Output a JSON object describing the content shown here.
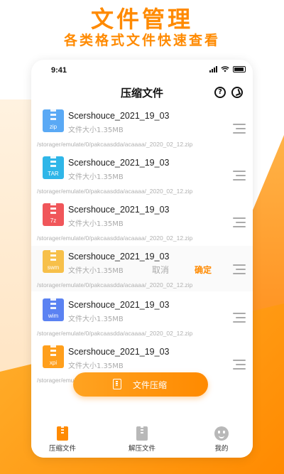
{
  "hero": {
    "title": "文件管理",
    "subtitle": "各类格式文件快速查看"
  },
  "status_bar": {
    "time": "9:41"
  },
  "nav": {
    "title": "压缩文件",
    "help_glyph": "?"
  },
  "files": [
    {
      "name": "Scershouce_2021_19_03",
      "size": "文件大小1.35MB",
      "path": "/storager/emulate/0/pakcaasdda/acaaaa/_2020_02_12.zip",
      "ext": "zip",
      "icon_color": "#5aa9f5"
    },
    {
      "name": "Scershouce_2021_19_03",
      "size": "文件大小1.35MB",
      "path": "/storager/emulate/0/pakcaasdda/acaaaa/_2020_02_12.zip",
      "ext": "TAR",
      "icon_color": "#2fb6e8"
    },
    {
      "name": "Scershouce_2021_19_03",
      "size": "文件大小1.35MB",
      "path": "/storager/emulate/0/pakcaasdda/acaaaa/_2020_02_12.zip",
      "ext": "7z",
      "icon_color": "#f0565a"
    },
    {
      "name": "Scershouce_2021_19_03",
      "size": "文件大小1.35MB",
      "path": "/storager/emulate/0/pakcaasdda/acaaaa/_2020_02_12.zip",
      "ext": "swm",
      "icon_color": "#f7c04a"
    },
    {
      "name": "Scershouce_2021_19_03",
      "size": "文件大小1.35MB",
      "path": "/storager/emulate/0/pakcaasdda/acaaaa/_2020_02_12.zip",
      "ext": "wim",
      "icon_color": "#5b82f2"
    },
    {
      "name": "Scershouce_2021_19_03",
      "size": "文件大小1.35MB",
      "path": "/storager/emulate/0/pakcaasdda/acaaaa/_2020_02_12.zip",
      "ext": "xpi",
      "icon_color": "#ff9f1c"
    }
  ],
  "inline_actions": {
    "cancel": "取消",
    "confirm": "确定"
  },
  "fab": {
    "label": "文件压缩"
  },
  "tabs": [
    {
      "label": "压缩文件",
      "active": true
    },
    {
      "label": "解压文件",
      "active": false
    },
    {
      "label": "我的",
      "active": false
    }
  ],
  "colors": {
    "accent": "#ff8a00"
  }
}
